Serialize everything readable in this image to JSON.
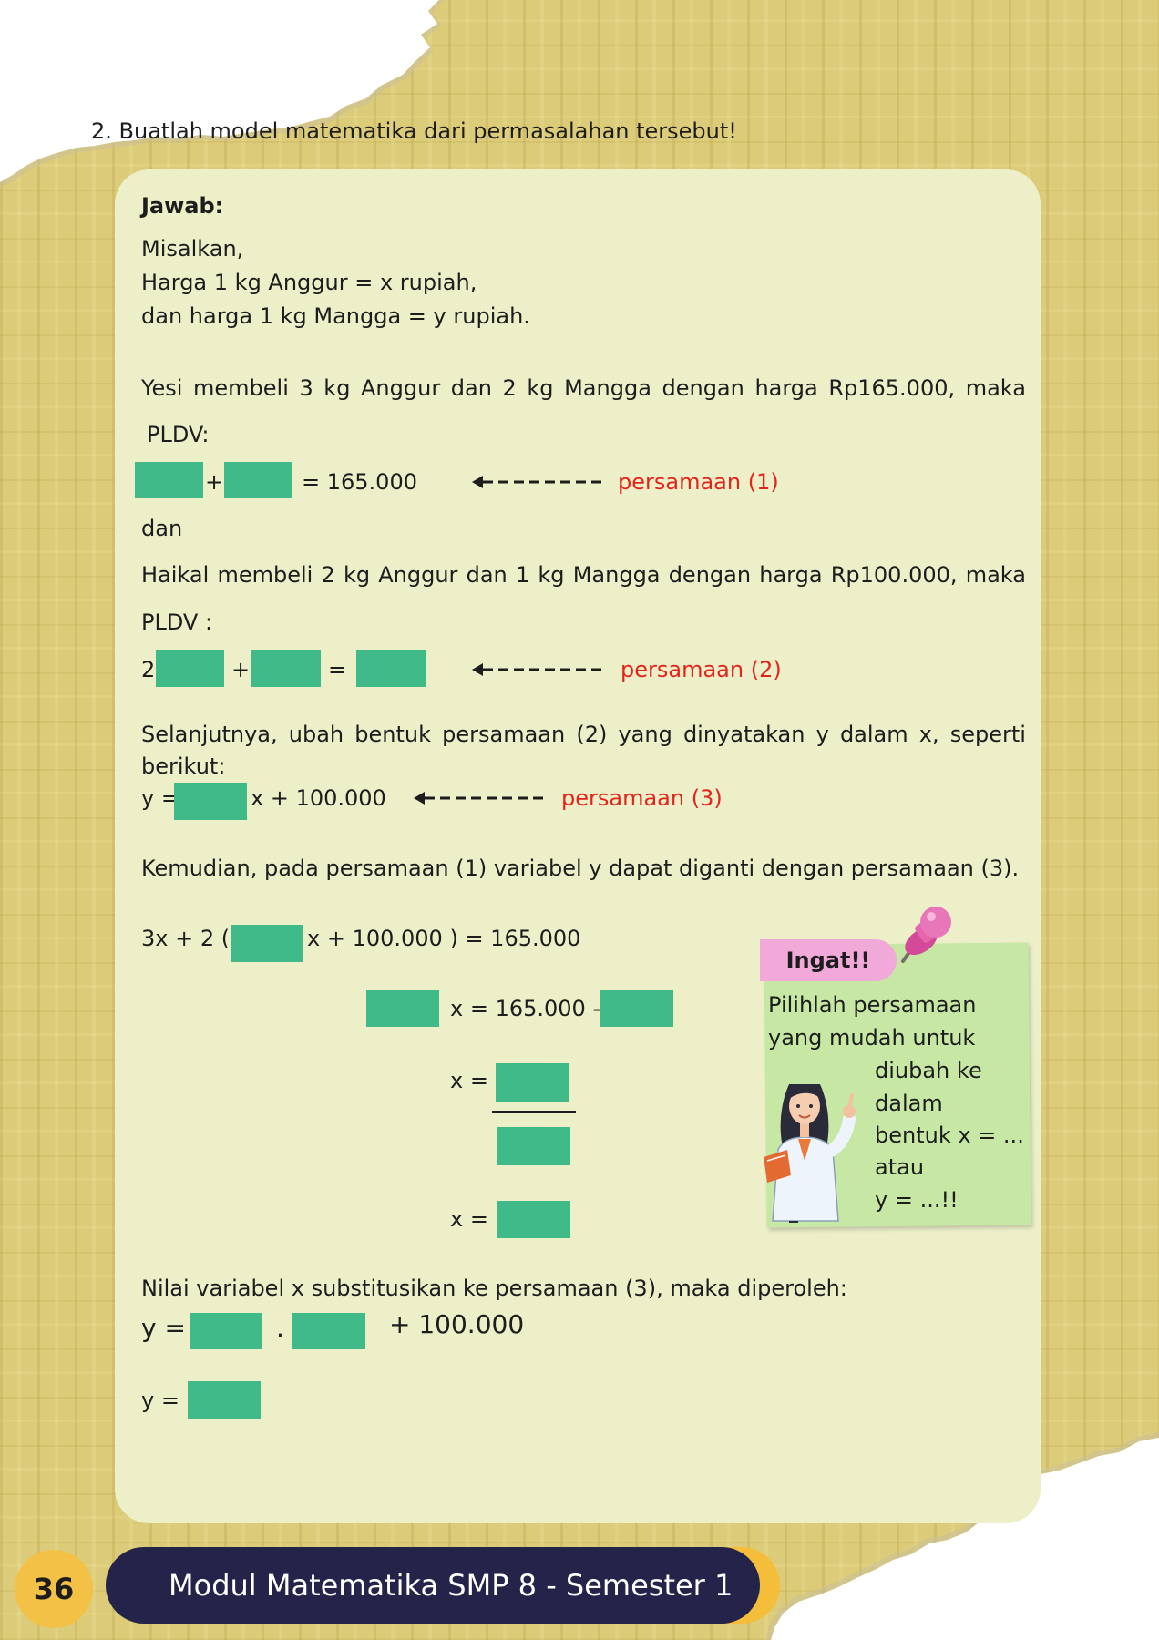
{
  "question": "2.  Buatlah model matematika dari permasalahan tersebut!",
  "answer": {
    "heading": "Jawab:",
    "let_intro": "Misalkan,",
    "let_x": "Harga 1 kg Anggur = x rupiah,",
    "let_y": "dan harga 1 kg Mangga = y rupiah.",
    "yesi_line": [
      "Yesi",
      "membeli",
      "3",
      "kg",
      "Anggur",
      "dan",
      "2",
      "kg",
      "Mangga",
      "dengan",
      "harga",
      "Rp165.000,",
      "maka"
    ],
    "yesi_pldv": "PLDV:",
    "eq1_plus": "+",
    "eq1_rhs": "= 165.000",
    "eq1_label": "persamaan (1)",
    "dan": "dan",
    "haikal_line": [
      "Haikal",
      "membeli",
      "2",
      "kg",
      "Anggur",
      "dan",
      "1",
      "kg",
      "Mangga",
      "dengan",
      "harga",
      "Rp100.000,",
      "maka"
    ],
    "haikal_pldv": "PLDV :",
    "eq2_coef": "2",
    "eq2_plus": "+",
    "eq2_equals": "=",
    "eq2_label": "persamaan (2)",
    "transform_line": [
      "Selanjutnya,",
      "ubah",
      "bentuk",
      "persamaan",
      "(2)",
      "yang",
      "dinyatakan",
      "y",
      "dalam",
      "x,",
      "seperti"
    ],
    "transform_line2": "berikut:",
    "eq3_lhs": "y =",
    "eq3_rhs": "x + 100.000",
    "eq3_label": "persamaan (3)",
    "substitute_line": "Kemudian, pada persamaan (1) variabel y dapat diganti dengan persamaan (3).",
    "sub_lhs": "3x  + 2 (",
    "sub_rhs": "x + 100.000 ) = 165.000",
    "step2_mid": "x = 165.000 -",
    "step3_lhs": "x =",
    "step4_lhs": "x =",
    "final_line": "Nilai variabel x substitusikan ke persamaan (3), maka diperoleh:",
    "final_y1": "y =",
    "final_dot": ".",
    "final_plus": "+ 100.000",
    "final_y2": "y ="
  },
  "note": {
    "label": "Ingat!!",
    "line1": "Pilihlah persamaan",
    "line2": "yang mudah untuk",
    "line3": "diubah ke",
    "line4": "dalam",
    "line5": "bentuk x = ...",
    "line6": "atau",
    "line7": "y = ...!!"
  },
  "footer": {
    "page_number": "36",
    "title": "Modul Matematika SMP 8 - Semester 1"
  },
  "colors": {
    "answer_box": "#3fba88",
    "label_red": "#e4231c",
    "card_bg": "#ecefc8",
    "footer_navy": "#24234a",
    "footer_gold": "#f3c145"
  }
}
